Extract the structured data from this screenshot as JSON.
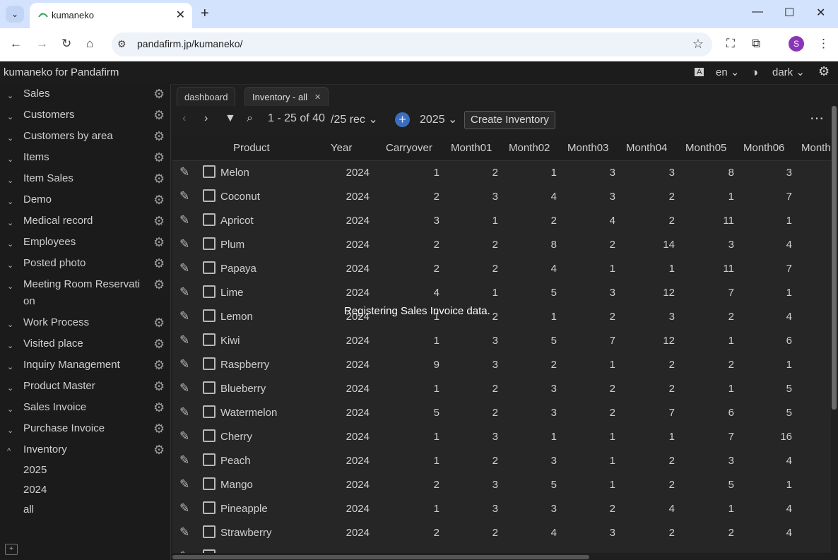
{
  "browser": {
    "tab_title": "kumaneko",
    "url": "pandafirm.jp/kumaneko/",
    "profile_initial": "S"
  },
  "app": {
    "title": "kumaneko for Pandafirm",
    "language": "en",
    "theme": "dark"
  },
  "sidebar": {
    "items": [
      {
        "label": "Sales"
      },
      {
        "label": "Customers"
      },
      {
        "label": "Customers by area"
      },
      {
        "label": "Items"
      },
      {
        "label": "Item Sales"
      },
      {
        "label": "Demo"
      },
      {
        "label": "Medical record"
      },
      {
        "label": "Employees"
      },
      {
        "label": "Posted photo"
      },
      {
        "label": "Meeting Room Reservati\non"
      },
      {
        "label": "Work Process"
      },
      {
        "label": "Visited place"
      },
      {
        "label": "Inquiry Management"
      },
      {
        "label": "Product Master"
      },
      {
        "label": "Sales Invoice"
      },
      {
        "label": "Purchase Invoice"
      },
      {
        "label": "Inventory"
      }
    ],
    "inventory_views": [
      "2025",
      "2024",
      "all"
    ]
  },
  "tabs": [
    {
      "label": "dashboard"
    },
    {
      "label": "Inventory - all"
    }
  ],
  "toolbar": {
    "range": "1 - 25 of 40",
    "per_page": "/25 rec",
    "year": "2025",
    "create_label": "Create Inventory"
  },
  "grid": {
    "columns": [
      "Product",
      "Year",
      "Carryover",
      "Month01",
      "Month02",
      "Month03",
      "Month04",
      "Month05",
      "Month06",
      "Month"
    ],
    "rows": [
      {
        "product": "Melon",
        "year": "2024",
        "v": [
          "1",
          "2",
          "1",
          "3",
          "3",
          "8",
          "3"
        ]
      },
      {
        "product": "Coconut",
        "year": "2024",
        "v": [
          "2",
          "3",
          "4",
          "3",
          "2",
          "1",
          "7"
        ]
      },
      {
        "product": "Apricot",
        "year": "2024",
        "v": [
          "3",
          "1",
          "2",
          "4",
          "2",
          "11",
          "1"
        ]
      },
      {
        "product": "Plum",
        "year": "2024",
        "v": [
          "2",
          "2",
          "8",
          "2",
          "14",
          "3",
          "4"
        ]
      },
      {
        "product": "Papaya",
        "year": "2024",
        "v": [
          "2",
          "2",
          "4",
          "1",
          "1",
          "11",
          "7"
        ]
      },
      {
        "product": "Lime",
        "year": "2024",
        "v": [
          "4",
          "1",
          "5",
          "3",
          "12",
          "7",
          "1"
        ]
      },
      {
        "product": "Lemon",
        "year": "2024",
        "v": [
          "1",
          "2",
          "1",
          "2",
          "3",
          "2",
          "4"
        ]
      },
      {
        "product": "Kiwi",
        "year": "2024",
        "v": [
          "1",
          "3",
          "5",
          "7",
          "12",
          "1",
          "6"
        ]
      },
      {
        "product": "Raspberry",
        "year": "2024",
        "v": [
          "9",
          "3",
          "2",
          "1",
          "2",
          "2",
          "1"
        ]
      },
      {
        "product": "Blueberry",
        "year": "2024",
        "v": [
          "1",
          "2",
          "3",
          "2",
          "2",
          "1",
          "5"
        ]
      },
      {
        "product": "Watermelon",
        "year": "2024",
        "v": [
          "5",
          "2",
          "3",
          "2",
          "7",
          "6",
          "5"
        ]
      },
      {
        "product": "Cherry",
        "year": "2024",
        "v": [
          "1",
          "3",
          "1",
          "1",
          "1",
          "7",
          "16"
        ]
      },
      {
        "product": "Peach",
        "year": "2024",
        "v": [
          "1",
          "2",
          "3",
          "1",
          "2",
          "3",
          "4"
        ]
      },
      {
        "product": "Mango",
        "year": "2024",
        "v": [
          "2",
          "3",
          "5",
          "1",
          "2",
          "5",
          "1"
        ]
      },
      {
        "product": "Pineapple",
        "year": "2024",
        "v": [
          "1",
          "3",
          "3",
          "2",
          "4",
          "1",
          "4"
        ]
      },
      {
        "product": "Strawberry",
        "year": "2024",
        "v": [
          "2",
          "2",
          "4",
          "3",
          "2",
          "2",
          "4"
        ]
      }
    ]
  },
  "toast": "Registering Sales Invoice data."
}
